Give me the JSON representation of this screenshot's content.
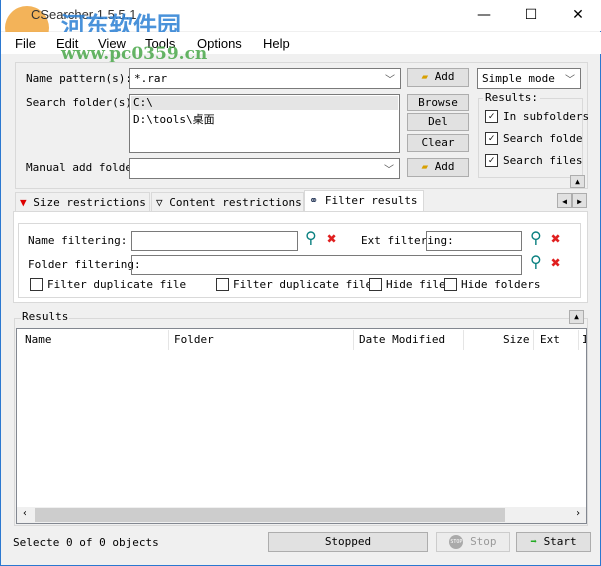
{
  "window": {
    "title": "CSearcher 1.5.5.1",
    "minimize": "—",
    "maximize": "☐",
    "close": "✕",
    "watermark": "河东软件园",
    "watermark_url": "www.pc0359.cn"
  },
  "menu": [
    "File",
    "Edit",
    "View",
    "Tools",
    "Options",
    "Help"
  ],
  "search": {
    "name_label": "Name pattern(s):",
    "name_value": "*.rar",
    "folder_label": "Search folder(s):",
    "folders": [
      "C:\\",
      "D:\\tools\\桌面"
    ],
    "manual_label": "Manual add folder",
    "manual_value": "",
    "add": "Add",
    "browse": "Browse",
    "del": "Del",
    "clear": "Clear",
    "add2": "Add",
    "mode": "Simple mode"
  },
  "results_opts": {
    "title": "Results:",
    "items": [
      {
        "label": "In subfolders",
        "checked": true
      },
      {
        "label": "Search folder:",
        "checked": true
      },
      {
        "label": "Search files",
        "checked": true
      }
    ]
  },
  "tabs": [
    "Size restrictions",
    "Content restrictions",
    "Filter results"
  ],
  "filter": {
    "name_label": "Name filtering:",
    "ext_label": "Ext filtering:",
    "folder_label": "Folder filtering:",
    "checks": [
      "Filter duplicate files (name",
      "Filter duplicate files",
      "Hide files",
      "Hide folders"
    ]
  },
  "results": {
    "title": "Results",
    "columns": [
      "Name",
      "Folder",
      "Date Modified",
      "Size",
      "Ext",
      "I"
    ]
  },
  "status": {
    "text": "Selecte 0 of 0 objects",
    "state": "Stopped",
    "stop": "Stop",
    "start": "Start",
    "stop_icon": "STOP"
  }
}
